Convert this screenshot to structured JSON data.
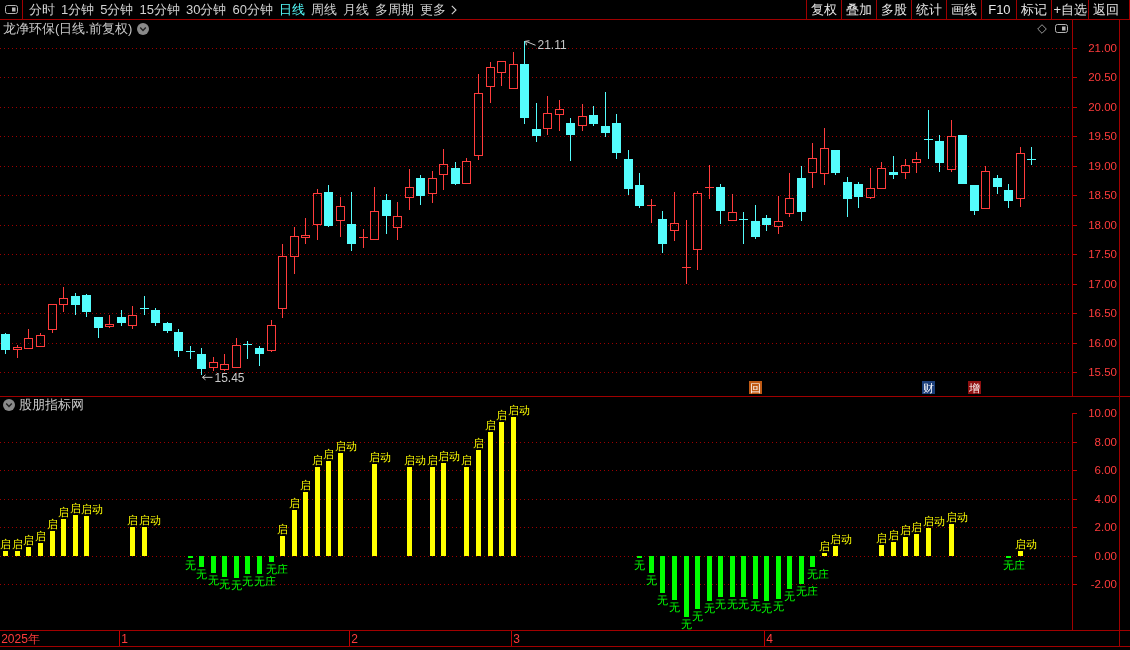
{
  "toolbar": {
    "periods": [
      {
        "label": "分时",
        "selected": false,
        "kind": "period"
      },
      {
        "label": "1分钟",
        "selected": false,
        "kind": "period"
      },
      {
        "label": "5分钟",
        "selected": false,
        "kind": "period"
      },
      {
        "label": "15分钟",
        "selected": false,
        "kind": "period"
      },
      {
        "label": "30分钟",
        "selected": false,
        "kind": "period"
      },
      {
        "label": "60分钟",
        "selected": false,
        "kind": "period"
      },
      {
        "label": "日线",
        "selected": true,
        "kind": "period"
      },
      {
        "label": "周线",
        "selected": false,
        "kind": "period"
      },
      {
        "label": "月线",
        "selected": false,
        "kind": "period"
      },
      {
        "label": "多周期",
        "selected": false,
        "kind": "period"
      },
      {
        "label": "更多",
        "selected": false,
        "kind": "menu"
      }
    ],
    "actions": [
      "复权",
      "叠加",
      "多股",
      "统计",
      "画线",
      "F10",
      "标记",
      "+自选",
      "返回"
    ]
  },
  "price_pane": {
    "title": "龙净环保(日线.前复权)",
    "chart_data": {
      "type": "candlestick",
      "ylim": [
        15.1,
        21.47
      ],
      "yticks": [
        {
          "value": 21,
          "label": "21.00"
        },
        {
          "value": 20.5,
          "label": "20.50"
        },
        {
          "value": 20,
          "label": "20.00"
        },
        {
          "value": 19.5,
          "label": "19.50"
        },
        {
          "value": 19,
          "label": "19.00"
        },
        {
          "value": 18.5,
          "label": "18.50"
        },
        {
          "value": 18,
          "label": "18.00"
        },
        {
          "value": 17.5,
          "label": "17.50"
        },
        {
          "value": 17,
          "label": "17.00"
        },
        {
          "value": 16.5,
          "label": "16.50"
        },
        {
          "value": 16,
          "label": "16.00"
        },
        {
          "value": 15.5,
          "label": "15.50"
        }
      ],
      "grid": true,
      "categories": [
        null,
        null,
        null,
        null,
        null,
        null,
        null,
        null,
        null,
        null,
        null,
        null,
        null,
        null,
        null,
        null,
        null,
        null,
        null,
        null,
        null,
        null,
        null,
        null,
        null,
        null,
        null,
        null,
        null,
        null,
        null,
        null,
        null,
        null,
        null,
        null,
        null,
        null,
        null,
        null,
        null,
        null,
        null,
        null,
        null,
        null,
        null,
        null,
        null,
        null,
        null,
        null,
        null,
        null,
        null,
        null,
        null,
        null,
        null,
        null,
        null,
        null,
        null,
        null,
        null,
        "回",
        null,
        null,
        null,
        null,
        null,
        null,
        null,
        null,
        null,
        null,
        null,
        null,
        null,
        null,
        "财",
        null,
        null,
        null,
        "增",
        null,
        null,
        null,
        null,
        null
      ],
      "ohlc": [
        [
          16.15,
          16.16,
          15.81,
          15.88
        ],
        [
          15.88,
          15.97,
          15.75,
          15.93
        ],
        [
          15.91,
          16.23,
          15.91,
          16.07
        ],
        [
          15.94,
          16.17,
          15.94,
          16.12
        ],
        [
          16.22,
          16.65,
          16.17,
          16.65
        ],
        [
          16.65,
          16.94,
          16.52,
          16.76
        ],
        [
          16.79,
          16.84,
          16.48,
          16.65
        ],
        [
          16.81,
          16.82,
          16.44,
          16.52
        ],
        [
          16.44,
          16.44,
          16.08,
          16.25
        ],
        [
          16.27,
          16.48,
          16.25,
          16.31
        ],
        [
          16.44,
          16.56,
          16.29,
          16.33
        ],
        [
          16.29,
          16.62,
          16.23,
          16.47
        ],
        [
          16.58,
          16.79,
          16.48,
          16.57
        ],
        [
          16.56,
          16.59,
          16.29,
          16.33
        ],
        [
          16.33,
          16.35,
          16.17,
          16.2
        ],
        [
          16.18,
          16.24,
          15.76,
          15.87
        ],
        [
          15.85,
          15.95,
          15.72,
          15.83
        ],
        [
          15.81,
          15.92,
          15.45,
          15.56
        ],
        [
          15.58,
          15.76,
          15.53,
          15.67
        ],
        [
          15.55,
          15.81,
          15.53,
          15.64
        ],
        [
          15.58,
          16.08,
          15.58,
          15.96
        ],
        [
          15.97,
          16.03,
          15.72,
          15.96
        ],
        [
          15.92,
          15.94,
          15.61,
          15.81
        ],
        [
          15.87,
          16.38,
          15.85,
          16.29
        ],
        [
          16.59,
          17.68,
          16.42,
          17.47
        ],
        [
          17.47,
          17.96,
          17.16,
          17.81
        ],
        [
          17.79,
          18.11,
          17.67,
          17.82
        ],
        [
          18.0,
          18.61,
          17.75,
          18.53
        ],
        [
          18.55,
          18.67,
          17.96,
          17.98
        ],
        [
          18.08,
          18.47,
          17.79,
          18.31
        ],
        [
          18.01,
          18.55,
          17.55,
          17.67
        ],
        [
          17.78,
          17.93,
          17.61,
          17.79
        ],
        [
          17.75,
          18.64,
          17.75,
          18.23
        ],
        [
          18.42,
          18.53,
          17.85,
          18.15
        ],
        [
          17.96,
          18.39,
          17.75,
          18.14
        ],
        [
          18.47,
          18.94,
          18.25,
          18.64
        ],
        [
          18.79,
          18.85,
          18.34,
          18.49
        ],
        [
          18.53,
          18.92,
          18.37,
          18.79
        ],
        [
          18.85,
          19.29,
          18.59,
          19.02
        ],
        [
          18.96,
          19.07,
          18.68,
          18.7
        ],
        [
          18.7,
          19.14,
          18.7,
          19.07
        ],
        [
          19.17,
          20.55,
          19.1,
          20.23
        ],
        [
          20.34,
          20.76,
          20.07,
          20.67
        ],
        [
          20.58,
          20.76,
          20.35,
          20.76
        ],
        [
          20.31,
          20.92,
          20.31,
          20.72
        ],
        [
          20.73,
          21.11,
          19.7,
          19.81
        ],
        [
          19.62,
          20.06,
          19.41,
          19.5
        ],
        [
          19.64,
          20.19,
          19.52,
          19.88
        ],
        [
          19.87,
          20.11,
          19.59,
          19.96
        ],
        [
          19.73,
          19.81,
          19.08,
          19.52
        ],
        [
          19.68,
          20.05,
          19.59,
          19.84
        ],
        [
          19.86,
          20.01,
          19.67,
          19.7
        ],
        [
          19.67,
          20.25,
          19.48,
          19.56
        ],
        [
          19.73,
          19.88,
          19.12,
          19.22
        ],
        [
          19.12,
          19.26,
          18.5,
          18.61
        ],
        [
          18.68,
          18.87,
          18.29,
          18.32
        ],
        [
          18.31,
          18.44,
          18.03,
          18.32
        ],
        [
          18.1,
          18.23,
          17.53,
          17.67
        ],
        [
          17.91,
          18.55,
          17.72,
          18.02
        ],
        [
          17.27,
          18.09,
          17.0,
          17.28
        ],
        [
          17.59,
          18.58,
          17.24,
          18.53
        ],
        [
          18.62,
          19.02,
          18.43,
          18.63
        ],
        [
          18.64,
          18.7,
          18.02,
          18.24
        ],
        [
          18.08,
          18.52,
          18.08,
          18.21
        ],
        [
          18.09,
          18.21,
          17.67,
          18.08
        ],
        [
          18.06,
          18.33,
          17.76,
          17.79
        ],
        [
          18.12,
          18.16,
          17.9,
          18.0
        ],
        [
          17.97,
          18.49,
          17.85,
          18.06
        ],
        [
          18.2,
          18.87,
          18.14,
          18.44
        ],
        [
          18.79,
          19.0,
          18.07,
          18.22
        ],
        [
          18.88,
          19.39,
          18.62,
          19.12
        ],
        [
          18.87,
          19.64,
          18.67,
          19.29
        ],
        [
          19.27,
          19.27,
          18.85,
          18.88
        ],
        [
          18.72,
          18.81,
          18.14,
          18.44
        ],
        [
          18.7,
          18.73,
          18.29,
          18.47
        ],
        [
          18.47,
          18.96,
          18.43,
          18.62
        ],
        [
          18.61,
          19.06,
          18.61,
          18.95
        ],
        [
          18.9,
          19.16,
          18.78,
          18.85
        ],
        [
          18.88,
          19.11,
          18.78,
          19.0
        ],
        [
          19.05,
          19.23,
          18.87,
          19.1
        ],
        [
          19.45,
          19.95,
          19.12,
          19.44
        ],
        [
          19.42,
          19.53,
          18.9,
          19.04
        ],
        [
          18.93,
          19.78,
          18.9,
          19.49
        ],
        [
          19.52,
          19.53,
          18.7,
          18.7
        ],
        [
          18.68,
          18.68,
          18.17,
          18.24
        ],
        [
          18.28,
          18.99,
          18.28,
          18.9
        ],
        [
          18.79,
          18.85,
          18.52,
          18.64
        ],
        [
          18.59,
          18.7,
          18.29,
          18.4
        ],
        [
          18.44,
          19.31,
          18.3,
          19.2
        ],
        [
          19.1,
          19.31,
          19.01,
          19.09
        ]
      ],
      "annotations": [
        "21.11",
        "15.45"
      ]
    },
    "badges": [
      {
        "color": "#c05a14"
      },
      {
        "color": "#1c3f7a"
      },
      {
        "color": "#8e1010"
      }
    ]
  },
  "indicator_pane": {
    "title": "股朋指标网",
    "chart_data": {
      "type": "bar",
      "ylim": [
        -5.2,
        10
      ],
      "yticks": [
        {
          "value": 10,
          "label": "10.00"
        },
        {
          "value": 8,
          "label": "8.00"
        },
        {
          "value": 6,
          "label": "6.00"
        },
        {
          "value": 4,
          "label": "4.00"
        },
        {
          "value": 2,
          "label": "2.00"
        },
        {
          "value": 0,
          "label": "0.00"
        },
        {
          "value": -2,
          "label": "-2.00"
        }
      ],
      "grid": true,
      "categories": [
        null,
        "2025年",
        null,
        null,
        null,
        null,
        null,
        null,
        null,
        null,
        "1",
        null,
        null,
        null,
        null,
        null,
        null,
        null,
        null,
        null,
        null,
        null,
        null,
        null,
        null,
        null,
        null,
        null,
        null,
        null,
        "2",
        null,
        null,
        null,
        null,
        null,
        null,
        null,
        null,
        null,
        null,
        null,
        null,
        null,
        "3",
        null,
        null,
        null,
        null,
        null,
        null,
        null,
        null,
        null,
        null,
        null,
        null,
        null,
        null,
        null,
        null,
        null,
        null,
        null,
        null,
        null,
        "4",
        null,
        null,
        null,
        null,
        null,
        null,
        null,
        null,
        null,
        null,
        null,
        null,
        null,
        null,
        null,
        null,
        null,
        null,
        null,
        null,
        null,
        null,
        null
      ],
      "values": [
        0.3,
        0.35,
        0.6,
        0.9,
        1.75,
        2.55,
        2.85,
        2.8,
        null,
        null,
        null,
        2,
        2,
        null,
        null,
        null,
        -0.15,
        -0.8,
        -1.2,
        -1.5,
        -1.55,
        -1.3,
        -1.3,
        -0.45,
        1.35,
        3.2,
        4.45,
        6.2,
        6.65,
        7.2,
        null,
        null,
        6.4,
        null,
        null,
        6.25,
        null,
        6.25,
        6.5,
        null,
        6.2,
        7.4,
        8.7,
        9.4,
        9.75,
        null,
        null,
        null,
        null,
        null,
        null,
        null,
        null,
        null,
        null,
        -0.17,
        -1.2,
        -2.6,
        -3.1,
        -4.3,
        -3.75,
        -3.15,
        -2.9,
        -2.9,
        -2.9,
        -3.05,
        -3.15,
        -3.0,
        -2.35,
        -2.0,
        -0.8,
        0.2,
        0.65,
        null,
        null,
        null,
        0.75,
        0.95,
        1.3,
        1.55,
        1.95,
        null,
        2.25,
        null,
        null,
        null,
        null,
        -0.17,
        0.3,
        null
      ],
      "colors": [
        "#ffff00",
        "#ffff00",
        "#ffff00",
        "#ffff00",
        "#ffff00",
        "#ffff00",
        "#ffff00",
        "#ffff00",
        null,
        null,
        null,
        "#ffff00",
        "#ffff00",
        null,
        null,
        null,
        "#00ff00",
        "#00ff00",
        "#00ff00",
        "#00ff00",
        "#00ff00",
        "#00ff00",
        "#00ff00",
        "#00ff00",
        "#ffff00",
        "#ffff00",
        "#ffff00",
        "#ffff00",
        "#ffff00",
        "#ffff00",
        null,
        null,
        "#ffff00",
        null,
        null,
        "#ffff00",
        null,
        "#ffff00",
        "#ffff00",
        null,
        "#ffff00",
        "#ffff00",
        "#ffff00",
        "#ffff00",
        "#ffff00",
        null,
        null,
        null,
        null,
        null,
        null,
        null,
        null,
        null,
        null,
        "#00ff00",
        "#00ff00",
        "#00ff00",
        "#00ff00",
        "#00ff00",
        "#00ff00",
        "#00ff00",
        "#00ff00",
        "#00ff00",
        "#00ff00",
        "#00ff00",
        "#00ff00",
        "#00ff00",
        "#00ff00",
        "#00ff00",
        "#00ff00",
        "#ffff00",
        "#ffff00",
        null,
        null,
        null,
        "#ffff00",
        "#ffff00",
        "#ffff00",
        "#ffff00",
        "#ffff00",
        null,
        "#ffff00",
        null,
        null,
        null,
        null,
        "#00ff00",
        "#ffff00",
        null
      ],
      "value_labels": [
        "启",
        "启",
        "启",
        "启",
        "启",
        "启",
        "启",
        "启动",
        null,
        null,
        null,
        "启",
        "启动",
        null,
        null,
        null,
        "无",
        "无",
        "无",
        "无",
        "无",
        "无",
        "无庄",
        "无庄",
        "启",
        "启",
        "启",
        "启",
        "启",
        "启动",
        null,
        null,
        "启动",
        null,
        null,
        "启动",
        null,
        "启",
        "启动",
        null,
        "启",
        "启",
        "启",
        "启",
        "启动",
        null,
        null,
        null,
        null,
        null,
        null,
        null,
        null,
        null,
        null,
        "无",
        "无",
        "无",
        "无",
        "无",
        "无",
        "无",
        "无",
        "无",
        "无",
        "无",
        "无",
        "无",
        "无",
        "无庄",
        "无庄",
        "启",
        "启动",
        null,
        null,
        null,
        "启",
        "启",
        "启",
        "启",
        "启动",
        null,
        "启动",
        null,
        null,
        null,
        null,
        "无庄",
        "启动",
        null
      ]
    }
  }
}
